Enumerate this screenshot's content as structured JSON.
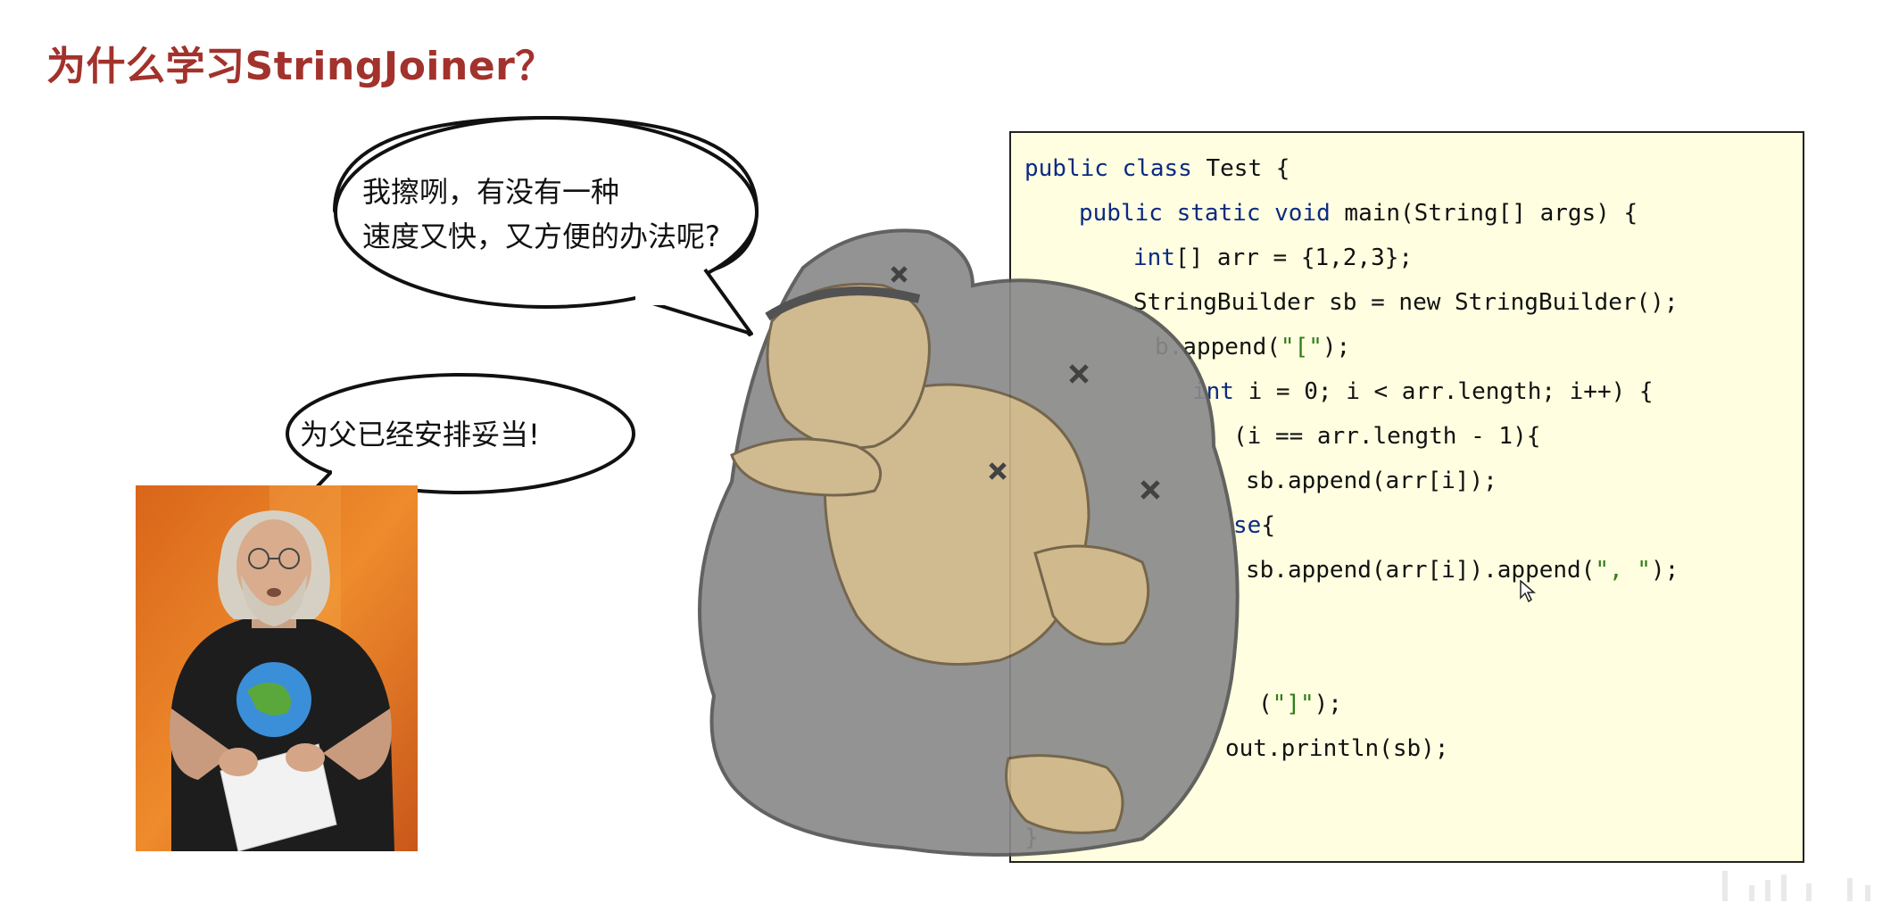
{
  "title": "为什么学习StringJoiner？",
  "bubble_top": {
    "line1": "我擦咧，有没有一种",
    "line2": "速度又快，又方便的办法呢?"
  },
  "bubble_bottom": {
    "text": "为父已经安排妥当!"
  },
  "code": {
    "l1_kw": "public class",
    "l1_rest": " Test {",
    "l2_kw": "public static void",
    "l2_rest": " main(String[] args) {",
    "l3_kw": "int",
    "l3_rest": "[] arr = {1,2,3};",
    "l4": "StringBuilder sb = new StringBuilder();",
    "l5_a": "b.append(",
    "l5_str": "\"[\"",
    "l5_b": ");",
    "l6_kw": "int",
    "l6_rest": " i = 0; i < arr.length; i++) {",
    "l7": "(i == arr.length - 1){",
    "l8": "sb.append(arr[i]);",
    "l9_kw": "se",
    "l9_rest": "{",
    "l10_a": "sb.append(arr[i]).append(",
    "l10_str": "\", \"",
    "l10_b": ");",
    "l14_a": "(",
    "l14_str": "\"]\"",
    "l14_b": ");",
    "l15": "out.println(sb);",
    "l17": "}"
  },
  "colors": {
    "title": "#a2322c",
    "code_bg": "#fffee0",
    "keyword": "#0b2a83",
    "string": "#2f7d1a"
  }
}
